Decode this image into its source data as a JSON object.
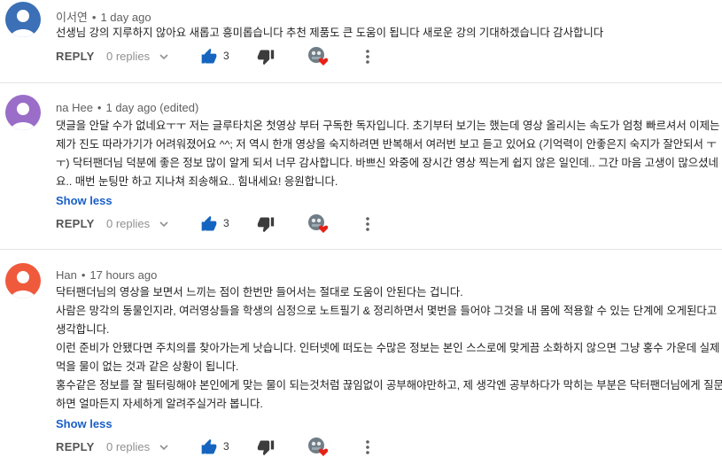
{
  "comments": [
    {
      "author": "이서연",
      "time": "1 day ago",
      "avatar_color": "#3b6fb6",
      "lines": [
        "선생님 강의  지루하지 않아요 새롭고 흥미롭습니다 추천 제품도 큰 도움이 됩니다  새로운 강의 기대하겠습니다 감사합니다"
      ],
      "reply_label": "REPLY",
      "replies_label": "0 replies",
      "like_count": "3"
    },
    {
      "author": "na Hee",
      "time": "1 day ago (edited)",
      "avatar_color": "#9a6ec8",
      "lines": [
        "댓글을 안달 수가 없네요ㅜㅜ 저는 글루타치온 첫영상 부터 구독한 독자입니다. 초기부터 보기는 했는데 영상 올리시는 속도가 엄청 빠르셔서 이제는",
        "제가 진도 따라가기가 어려워졌어요 ^^; 저 역시 한개 영상을 숙지하려면 반복해서 여러번 보고 듣고 있어요 (기억력이 안좋은지 숙지가 잘안되서 ㅜ",
        "ㅜ) 닥터팬더님 덕분에 좋은 정보 많이 알게 되서 너무 감사합니다. 바쁘신 와중에 장시간 영상 찍는게 쉽지 않은 일인데.. 그간 마음 고생이 많으셨네",
        "요.. 매번 눈팅만 하고 지나쳐 죄송해요.. 힘내세요! 응원합니다."
      ],
      "show_less": "Show less",
      "reply_label": "REPLY",
      "replies_label": "0 replies",
      "like_count": "3"
    },
    {
      "author": "Han",
      "time": "17 hours ago",
      "avatar_color": "#ef5a3d",
      "lines": [
        "닥터팬더님의 영상을 보면서 느끼는 점이 한번만 들어서는 절대로 도움이 안된다는 겁니다.",
        "사람은 망각의 동물인지라, 여러영상들을 학생의 심정으로 노트필기 & 정리하면서 몇번을 들어야 그것을 내 몸에 적용할 수 있는 단계에 오게된다고",
        "생각합니다.",
        "이런 준비가 안됐다면 주치의를 찾아가는게 낫습니다. 인터넷에 떠도는 수많은 정보는 본인 스스로에 맞게끔 소화하지 않으면 그냥 홍수 가운데 실제",
        "먹을 물이 없는 것과 같은 상황이 됩니다.",
        "홍수같은 정보를 잘 필터링해야 본인에게 맞는 물이 되는것처럼 끊임없이 공부해야만하고, 제 생각엔 공부하다가 막히는 부분은 닥터팬더님에게 질문",
        "하면 얼마든지 자세하게 알려주실거라 봅니다."
      ],
      "show_less": "Show less",
      "reply_label": "REPLY",
      "replies_label": "0 replies",
      "like_count": "3"
    }
  ]
}
